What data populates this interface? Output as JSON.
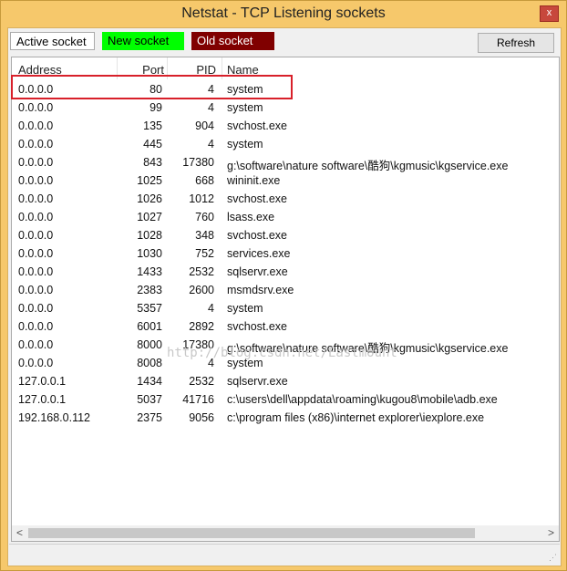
{
  "window": {
    "title": "Netstat - TCP Listening sockets",
    "close_label": "x"
  },
  "tabs": {
    "active": "Active socket",
    "new": "New socket",
    "old": "Old socket"
  },
  "toolbar": {
    "refresh_label": "Refresh"
  },
  "table": {
    "columns": [
      "Address",
      "Port",
      "PID",
      "Name"
    ],
    "rows": [
      [
        "0.0.0.0",
        "80",
        "4",
        "system"
      ],
      [
        "0.0.0.0",
        "99",
        "4",
        "system"
      ],
      [
        "0.0.0.0",
        "135",
        "904",
        "svchost.exe"
      ],
      [
        "0.0.0.0",
        "445",
        "4",
        "system"
      ],
      [
        "0.0.0.0",
        "843",
        "17380",
        "g:\\software\\nature software\\酷狗\\kgmusic\\kgservice.exe"
      ],
      [
        "0.0.0.0",
        "1025",
        "668",
        "wininit.exe"
      ],
      [
        "0.0.0.0",
        "1026",
        "1012",
        "svchost.exe"
      ],
      [
        "0.0.0.0",
        "1027",
        "760",
        "lsass.exe"
      ],
      [
        "0.0.0.0",
        "1028",
        "348",
        "svchost.exe"
      ],
      [
        "0.0.0.0",
        "1030",
        "752",
        "services.exe"
      ],
      [
        "0.0.0.0",
        "1433",
        "2532",
        "sqlservr.exe"
      ],
      [
        "0.0.0.0",
        "2383",
        "2600",
        "msmdsrv.exe"
      ],
      [
        "0.0.0.0",
        "5357",
        "4",
        "system"
      ],
      [
        "0.0.0.0",
        "6001",
        "2892",
        "svchost.exe"
      ],
      [
        "0.0.0.0",
        "8000",
        "17380",
        "g:\\software\\nature software\\酷狗\\kgmusic\\kgservice.exe"
      ],
      [
        "0.0.0.0",
        "8008",
        "4",
        "system"
      ],
      [
        "127.0.0.1",
        "1434",
        "2532",
        "sqlservr.exe"
      ],
      [
        "127.0.0.1",
        "5037",
        "41716",
        "c:\\users\\dell\\appdata\\roaming\\kugou8\\mobile\\adb.exe"
      ],
      [
        "192.168.0.112",
        "2375",
        "9056",
        "c:\\program files (x86)\\internet explorer\\iexplore.exe"
      ]
    ]
  },
  "watermark": "http://blog.csdn.net/Eastmount",
  "scrollbar": {
    "left_arrow": "<",
    "right_arrow": ">"
  },
  "statusbar": {
    "grip": "⋰"
  },
  "colors": {
    "new_socket": "#00ff00",
    "old_socket": "#800000",
    "highlight_border": "#d8202a",
    "titlebar": "#f6c86b"
  }
}
